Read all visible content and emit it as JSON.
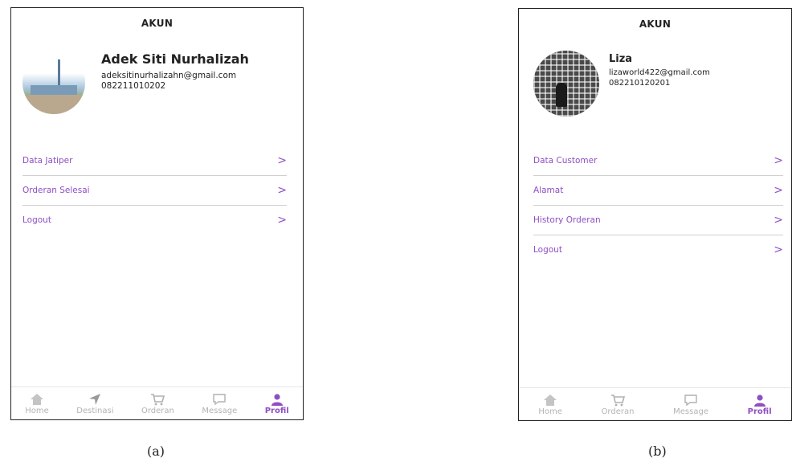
{
  "screen_a": {
    "title": "AKUN",
    "profile": {
      "name": "Adek Siti Nurhalizah",
      "email": "adeksitinurhalizahn@gmail.com",
      "phone": "082211010202"
    },
    "menu": [
      {
        "label": "Data Jatiper",
        "chevron": ">"
      },
      {
        "label": "Orderan Selesai",
        "chevron": ">"
      },
      {
        "label": "Logout",
        "chevron": ">"
      }
    ],
    "nav": [
      {
        "label": "Home",
        "icon": "home-icon"
      },
      {
        "label": "Destinasi",
        "icon": "navigation-arrow-icon"
      },
      {
        "label": "Orderan",
        "icon": "cart-icon"
      },
      {
        "label": "Message",
        "icon": "chat-bubble-icon"
      },
      {
        "label": "Profil",
        "icon": "user-icon",
        "active": true
      }
    ],
    "caption": "(a)"
  },
  "screen_b": {
    "title": "AKUN",
    "profile": {
      "name": "Liza",
      "email": "lizaworld422@gmail.com",
      "phone": "082210120201"
    },
    "menu": [
      {
        "label": "Data Customer",
        "chevron": ">"
      },
      {
        "label": "Alamat",
        "chevron": ">"
      },
      {
        "label": "History Orderan",
        "chevron": ">"
      },
      {
        "label": "Logout",
        "chevron": ">"
      }
    ],
    "nav": [
      {
        "label": "Home",
        "icon": "home-icon"
      },
      {
        "label": "Orderan",
        "icon": "cart-icon"
      },
      {
        "label": "Message",
        "icon": "chat-bubble-icon"
      },
      {
        "label": "Profil",
        "icon": "user-icon",
        "active": true
      }
    ],
    "caption": "(b)"
  },
  "colors": {
    "accent": "#8e4fc4",
    "inactive": "#b3b3b3",
    "divider": "#cfcfcf"
  }
}
